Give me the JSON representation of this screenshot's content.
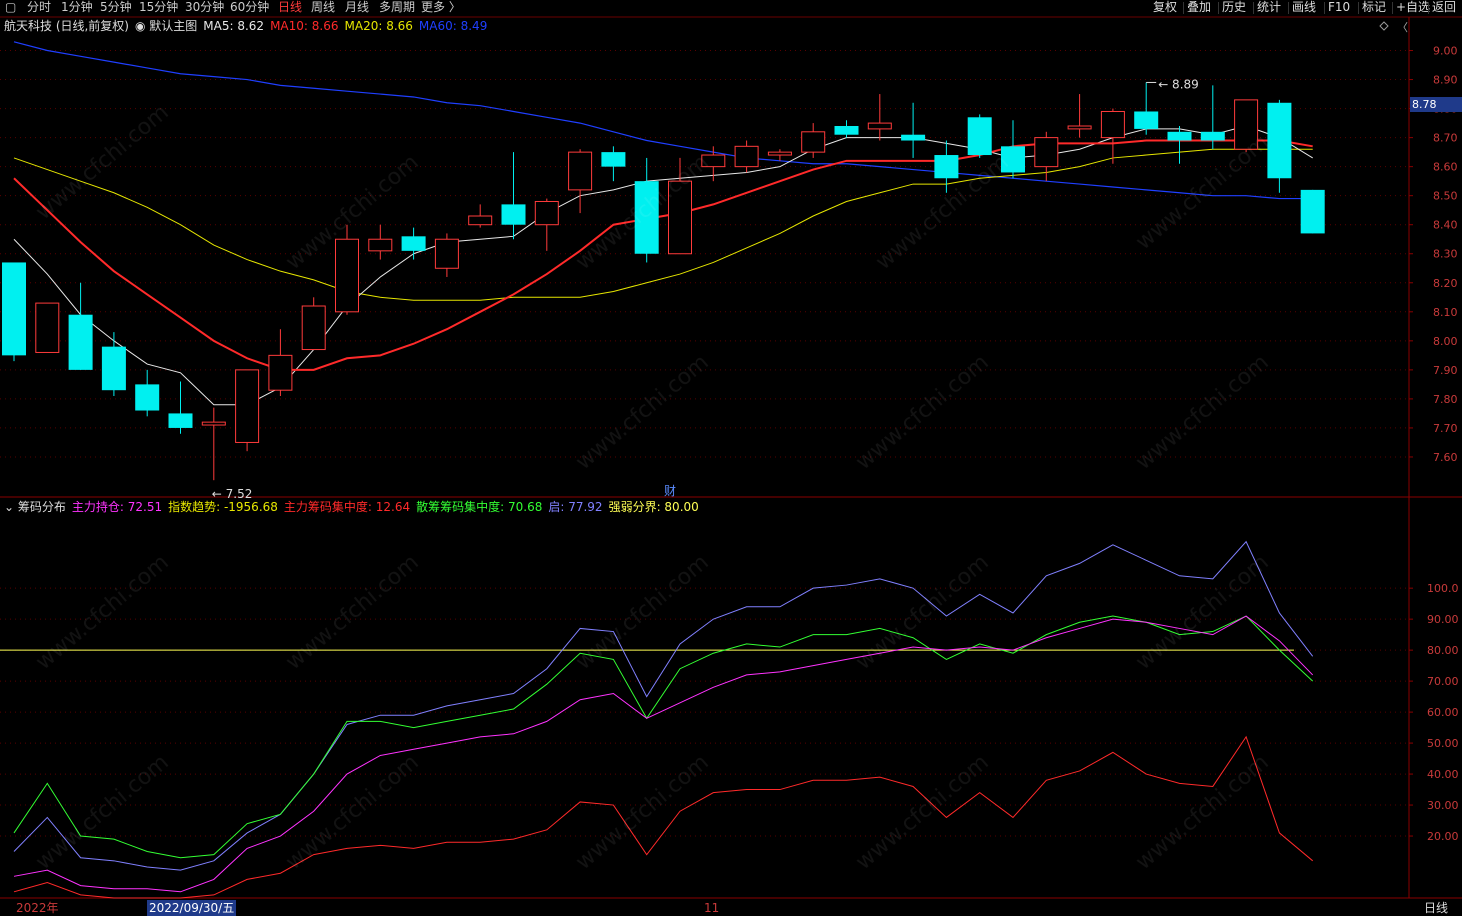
{
  "toolbar": {
    "left": [
      {
        "label": "分时"
      },
      {
        "label": "1分钟"
      },
      {
        "label": "5分钟"
      },
      {
        "label": "15分钟"
      },
      {
        "label": "30分钟"
      },
      {
        "label": "60分钟"
      },
      {
        "label": "日线",
        "active": true
      },
      {
        "label": "周线"
      },
      {
        "label": "月线"
      },
      {
        "label": "多周期"
      },
      {
        "label": "更多 〉"
      }
    ],
    "right": [
      {
        "label": "复权"
      },
      {
        "label": "叠加"
      },
      {
        "label": "历史"
      },
      {
        "label": "统计"
      },
      {
        "label": "画线"
      },
      {
        "label": "F10"
      },
      {
        "label": "标记"
      },
      {
        "label": "+自选"
      },
      {
        "label": "返回"
      }
    ]
  },
  "main_info": {
    "stock": "航天科技 (日线,前复权)",
    "template": "默认主图",
    "ma": [
      {
        "label": "MA5: 8.62",
        "color": "#e8e8e8"
      },
      {
        "label": "MA10: 8.66",
        "color": "#ff2a2a"
      },
      {
        "label": "MA20: 8.66",
        "color": "#e6e600"
      },
      {
        "label": "MA60: 8.49",
        "color": "#1f3fff"
      }
    ]
  },
  "sub_info": {
    "title": "筹码分布",
    "items": [
      {
        "label": "主力持仓: 72.51",
        "color": "#ff33ff"
      },
      {
        "label": "指数趋势: -1956.68",
        "color": "#e6e600"
      },
      {
        "label": "主力筹码集中度: 12.64",
        "color": "#ff2a2a"
      },
      {
        "label": "散筹筹码集中度: 70.68",
        "color": "#33ff33"
      },
      {
        "label": "启: 77.92",
        "color": "#8080ff"
      },
      {
        "label": "强弱分界: 80.00",
        "color": "#ffff55"
      }
    ]
  },
  "price_axis": {
    "labels": [
      "9.00",
      "8.90",
      "8.80",
      "8.70",
      "8.60",
      "8.50",
      "8.40",
      "8.30",
      "8.20",
      "8.10",
      "8.00",
      "7.90",
      "7.80",
      "7.70",
      "7.60"
    ],
    "current": "8.78"
  },
  "sub_axis": {
    "labels": [
      "100.0",
      "90.00",
      "80.00",
      "70.00",
      "60.00",
      "50.00",
      "40.00",
      "30.00",
      "20.00"
    ]
  },
  "annotations": {
    "high": "8.89",
    "low": "7.52",
    "event": "财"
  },
  "bottom": {
    "year": "2022年",
    "cursor_date": "2022/09/30/五",
    "month": "11",
    "period": "日线"
  },
  "watermark": "www.cfchi.com",
  "colors": {
    "up": "#ff3b3b",
    "down": "#00f0f0",
    "grid": "#5a0000"
  },
  "chart_data": [
    {
      "type": "candlestick",
      "ylim": [
        7.5,
        9.05
      ],
      "candles": [
        {
          "o": 8.27,
          "c": 7.95,
          "h": 8.27,
          "l": 7.93
        },
        {
          "o": 7.96,
          "c": 8.13,
          "h": 8.13,
          "l": 7.96
        },
        {
          "o": 8.09,
          "c": 7.9,
          "h": 8.2,
          "l": 7.9
        },
        {
          "o": 7.98,
          "c": 7.83,
          "h": 8.03,
          "l": 7.81
        },
        {
          "o": 7.85,
          "c": 7.76,
          "h": 7.9,
          "l": 7.74
        },
        {
          "o": 7.75,
          "c": 7.7,
          "h": 7.86,
          "l": 7.68
        },
        {
          "o": 7.71,
          "c": 7.72,
          "h": 7.77,
          "l": 7.52
        },
        {
          "o": 7.65,
          "c": 7.9,
          "h": 7.9,
          "l": 7.62
        },
        {
          "o": 7.83,
          "c": 7.95,
          "h": 8.04,
          "l": 7.81
        },
        {
          "o": 7.97,
          "c": 8.12,
          "h": 8.15,
          "l": 7.97
        },
        {
          "o": 8.1,
          "c": 8.35,
          "h": 8.4,
          "l": 8.09
        },
        {
          "o": 8.31,
          "c": 8.35,
          "h": 8.4,
          "l": 8.28
        },
        {
          "o": 8.36,
          "c": 8.31,
          "h": 8.39,
          "l": 8.28
        },
        {
          "o": 8.25,
          "c": 8.35,
          "h": 8.37,
          "l": 8.22
        },
        {
          "o": 8.4,
          "c": 8.43,
          "h": 8.47,
          "l": 8.39
        },
        {
          "o": 8.47,
          "c": 8.4,
          "h": 8.65,
          "l": 8.35
        },
        {
          "o": 8.4,
          "c": 8.48,
          "h": 8.49,
          "l": 8.31
        },
        {
          "o": 8.52,
          "c": 8.65,
          "h": 8.66,
          "l": 8.44
        },
        {
          "o": 8.65,
          "c": 8.6,
          "h": 8.67,
          "l": 8.55
        },
        {
          "o": 8.55,
          "c": 8.3,
          "h": 8.63,
          "l": 8.27
        },
        {
          "o": 8.3,
          "c": 8.55,
          "h": 8.63,
          "l": 8.3
        },
        {
          "o": 8.6,
          "c": 8.64,
          "h": 8.67,
          "l": 8.55
        },
        {
          "o": 8.6,
          "c": 8.67,
          "h": 8.69,
          "l": 8.58
        },
        {
          "o": 8.64,
          "c": 8.65,
          "h": 8.66,
          "l": 8.62
        },
        {
          "o": 8.65,
          "c": 8.72,
          "h": 8.75,
          "l": 8.63
        },
        {
          "o": 8.74,
          "c": 8.71,
          "h": 8.76,
          "l": 8.7
        },
        {
          "o": 8.73,
          "c": 8.75,
          "h": 8.85,
          "l": 8.69
        },
        {
          "o": 8.71,
          "c": 8.69,
          "h": 8.82,
          "l": 8.63
        },
        {
          "o": 8.64,
          "c": 8.56,
          "h": 8.69,
          "l": 8.51
        },
        {
          "o": 8.77,
          "c": 8.64,
          "h": 8.78,
          "l": 8.63
        },
        {
          "o": 8.67,
          "c": 8.58,
          "h": 8.76,
          "l": 8.56
        },
        {
          "o": 8.6,
          "c": 8.7,
          "h": 8.72,
          "l": 8.55
        },
        {
          "o": 8.73,
          "c": 8.74,
          "h": 8.85,
          "l": 8.7
        },
        {
          "o": 8.7,
          "c": 8.79,
          "h": 8.8,
          "l": 8.61
        },
        {
          "o": 8.79,
          "c": 8.73,
          "h": 8.89,
          "l": 8.71
        },
        {
          "o": 8.72,
          "c": 8.69,
          "h": 8.74,
          "l": 8.61
        },
        {
          "o": 8.72,
          "c": 8.69,
          "h": 8.88,
          "l": 8.66
        },
        {
          "o": 8.66,
          "c": 8.83,
          "h": 8.83,
          "l": 8.65
        },
        {
          "o": 8.82,
          "c": 8.56,
          "h": 8.83,
          "l": 8.51
        },
        {
          "o": 8.52,
          "c": 8.37,
          "h": 8.52,
          "l": 8.37
        }
      ],
      "ma5": [
        8.35,
        8.23,
        8.09,
        8.0,
        7.92,
        7.89,
        7.78,
        7.78,
        7.84,
        7.97,
        8.12,
        8.22,
        8.3,
        8.34,
        8.35,
        8.36,
        8.44,
        8.5,
        8.52,
        8.55,
        8.56,
        8.57,
        8.58,
        8.6,
        8.66,
        8.7,
        8.7,
        8.7,
        8.68,
        8.66,
        8.63,
        8.64,
        8.66,
        8.7,
        8.73,
        8.73,
        8.71,
        8.74,
        8.7,
        8.63
      ],
      "ma10": [
        8.56,
        8.45,
        8.34,
        8.24,
        8.16,
        8.08,
        8.0,
        7.94,
        7.9,
        7.9,
        7.94,
        7.95,
        7.99,
        8.04,
        8.1,
        8.16,
        8.23,
        8.31,
        8.4,
        8.42,
        8.44,
        8.47,
        8.51,
        8.55,
        8.59,
        8.62,
        8.62,
        8.62,
        8.62,
        8.64,
        8.67,
        8.68,
        8.68,
        8.68,
        8.69,
        8.69,
        8.69,
        8.69,
        8.69,
        8.67
      ],
      "ma20": [
        8.63,
        8.59,
        8.55,
        8.51,
        8.46,
        8.4,
        8.33,
        8.28,
        8.24,
        8.21,
        8.17,
        8.15,
        8.14,
        8.14,
        8.14,
        8.15,
        8.15,
        8.15,
        8.17,
        8.2,
        8.23,
        8.27,
        8.32,
        8.37,
        8.43,
        8.48,
        8.51,
        8.54,
        8.54,
        8.56,
        8.57,
        8.58,
        8.6,
        8.63,
        8.64,
        8.65,
        8.66,
        8.66,
        8.66,
        8.66
      ],
      "ma60": [
        9.03,
        9.0,
        8.98,
        8.96,
        8.94,
        8.92,
        8.91,
        8.9,
        8.88,
        8.87,
        8.86,
        8.85,
        8.84,
        8.82,
        8.81,
        8.79,
        8.77,
        8.75,
        8.72,
        8.69,
        8.67,
        8.65,
        8.63,
        8.62,
        8.61,
        8.61,
        8.6,
        8.59,
        8.58,
        8.57,
        8.56,
        8.55,
        8.54,
        8.53,
        8.52,
        8.51,
        8.5,
        8.5,
        8.49,
        8.49
      ]
    },
    {
      "type": "line",
      "ylim": [
        0,
        122
      ],
      "threshold": 80,
      "series": [
        {
          "name": "启",
          "color": "#8080ff",
          "values": [
            15,
            26,
            13,
            12,
            10,
            9,
            12,
            21,
            27,
            40,
            56,
            59,
            59,
            62,
            64,
            66,
            74,
            87,
            86,
            65,
            82,
            90,
            94,
            94,
            100,
            101,
            103,
            100,
            91,
            98,
            92,
            104,
            108,
            114,
            109,
            104,
            103,
            115,
            92,
            78
          ]
        },
        {
          "name": "散筹筹码集中度",
          "color": "#33ff33",
          "values": [
            21,
            37,
            20,
            19,
            15,
            13,
            14,
            24,
            27,
            40,
            57,
            57,
            55,
            57,
            59,
            61,
            69,
            79,
            77,
            58,
            74,
            79,
            82,
            81,
            85,
            85,
            87,
            84,
            77,
            82,
            79,
            85,
            89,
            91,
            89,
            85,
            86,
            91,
            80,
            70
          ]
        },
        {
          "name": "主力持仓",
          "color": "#ff33ff",
          "values": [
            7,
            9,
            4,
            3,
            3,
            2,
            6,
            16,
            20,
            28,
            40,
            46,
            48,
            50,
            52,
            53,
            57,
            64,
            66,
            58,
            63,
            68,
            72,
            73,
            75,
            77,
            79,
            81,
            80,
            81,
            80,
            84,
            87,
            90,
            89,
            87,
            85,
            91,
            83,
            72
          ]
        },
        {
          "name": "主力筹码集中度",
          "color": "#ff2a2a",
          "values": [
            2,
            5,
            1,
            0,
            0,
            0,
            1,
            6,
            8,
            14,
            16,
            17,
            16,
            18,
            18,
            19,
            22,
            31,
            30,
            14,
            28,
            34,
            35,
            35,
            38,
            38,
            39,
            36,
            26,
            34,
            26,
            38,
            41,
            47,
            40,
            37,
            36,
            52,
            21,
            12
          ]
        }
      ]
    }
  ]
}
